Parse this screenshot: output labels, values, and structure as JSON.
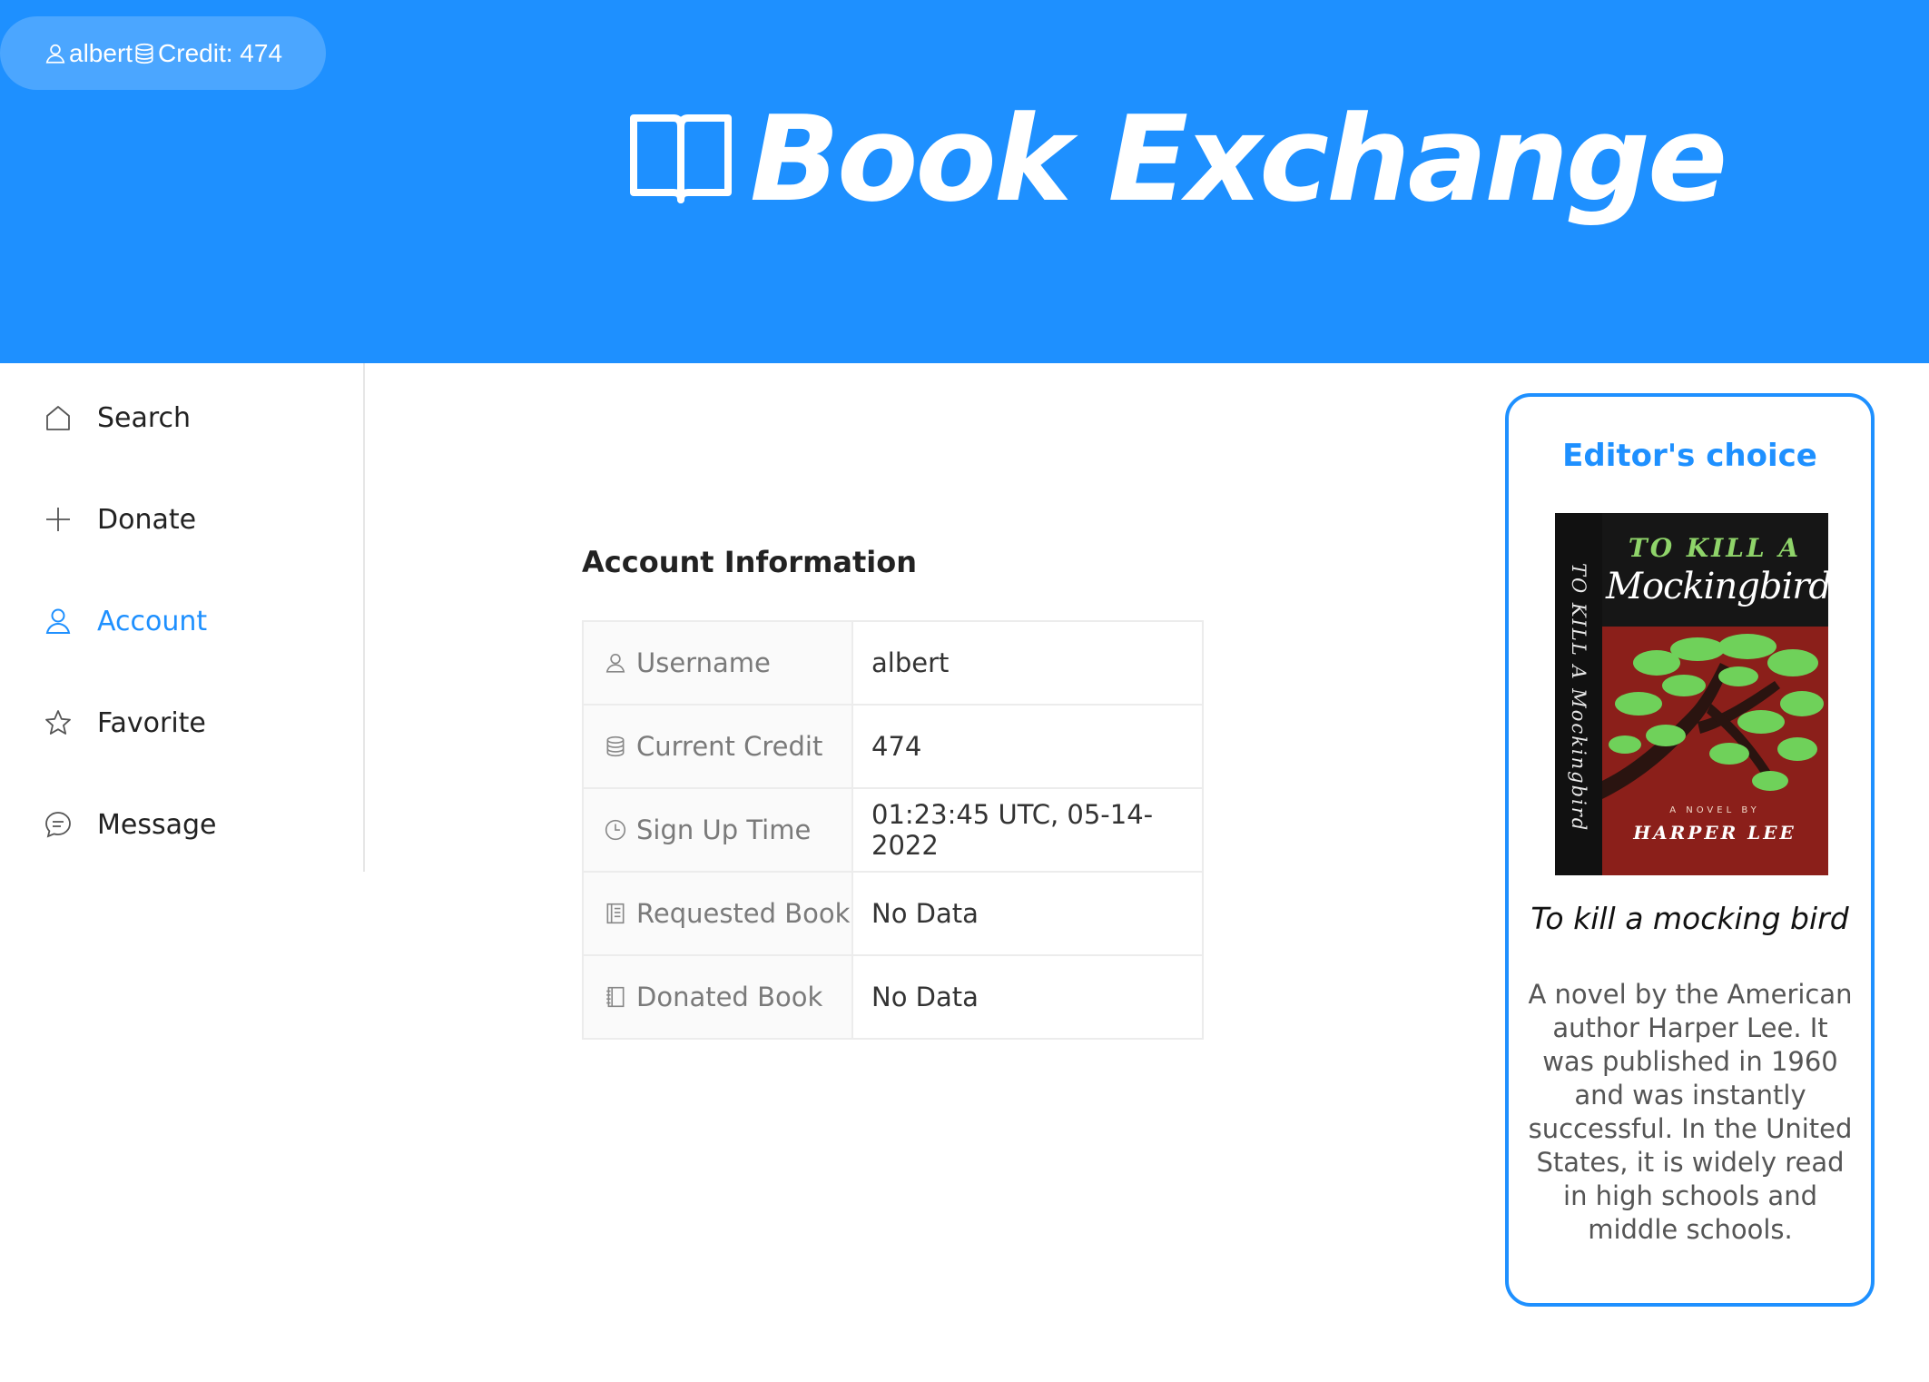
{
  "header": {
    "username": "albert",
    "credit_text": "Credit: 474",
    "brand_title": "Book Exchange",
    "colors": {
      "primary": "#1e90ff"
    }
  },
  "sidebar": {
    "items": [
      {
        "label": "Search",
        "icon": "home-icon",
        "active": false
      },
      {
        "label": "Donate",
        "icon": "plus-icon",
        "active": false
      },
      {
        "label": "Account",
        "icon": "user-icon",
        "active": true
      },
      {
        "label": "Favorite",
        "icon": "star-icon",
        "active": false
      },
      {
        "label": "Message",
        "icon": "message-icon",
        "active": false
      }
    ]
  },
  "main": {
    "section_title": "Account Information",
    "rows": [
      {
        "label": "Username",
        "icon": "user-icon",
        "value": "albert"
      },
      {
        "label": "Current Credit",
        "icon": "database-icon",
        "value": "474"
      },
      {
        "label": "Sign Up Time",
        "icon": "clock-icon",
        "value": "01:23:45 UTC, 05-14-2022"
      },
      {
        "label": "Requested Book",
        "icon": "book-list-icon",
        "value": "No Data"
      },
      {
        "label": "Donated Book",
        "icon": "notebook-icon",
        "value": "No Data"
      }
    ]
  },
  "editor_choice": {
    "title": "Editor's choice",
    "cover": {
      "top_line": "TO KILL A",
      "main_line": "Mockingbird",
      "spine": "TO KILL A Mockingbird",
      "byline": "A NOVEL BY",
      "author": "HARPER LEE"
    },
    "book_name": "To kill a mocking bird",
    "description": "A novel by the American author Harper Lee. It was published in 1960 and was instantly successful. In the United States, it is widely read in high schools and middle schools."
  }
}
